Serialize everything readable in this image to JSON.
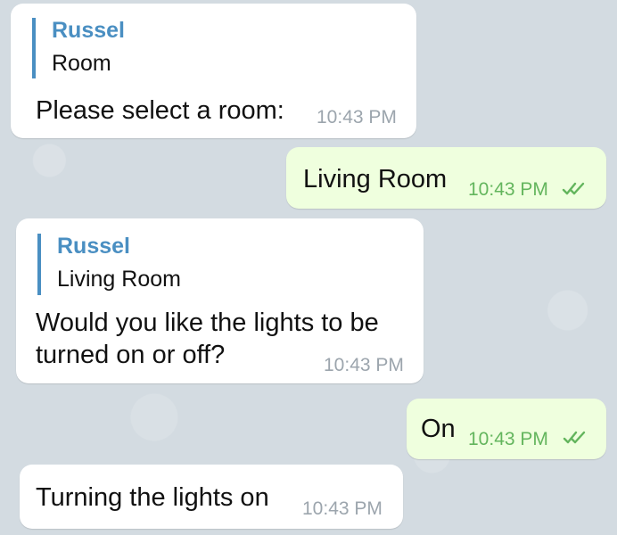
{
  "messages": [
    {
      "direction": "incoming",
      "reply_name": "Russel",
      "reply_text": "Room",
      "text": "Please select a room:",
      "time": "10:43 PM"
    },
    {
      "direction": "outgoing",
      "text": "Living Room",
      "time": "10:43 PM",
      "status_icon": "double-check-icon"
    },
    {
      "direction": "incoming",
      "reply_name": "Russel",
      "reply_text": "Living Room",
      "text_line_1": "Would you like the lights to be",
      "text_line_2": "turned on or off?",
      "time": "10:43 PM"
    },
    {
      "direction": "outgoing",
      "text": "On",
      "time": "10:43 PM",
      "status_icon": "double-check-icon"
    },
    {
      "direction": "incoming",
      "text": "Turning the lights on",
      "time": "10:43 PM"
    }
  ],
  "colors": {
    "incoming_bubble": "#ffffff",
    "outgoing_bubble": "#efffde",
    "reply_accent": "#4a8fc2",
    "timestamp_incoming": "#9ca5ad",
    "timestamp_outgoing": "#63b55d"
  }
}
